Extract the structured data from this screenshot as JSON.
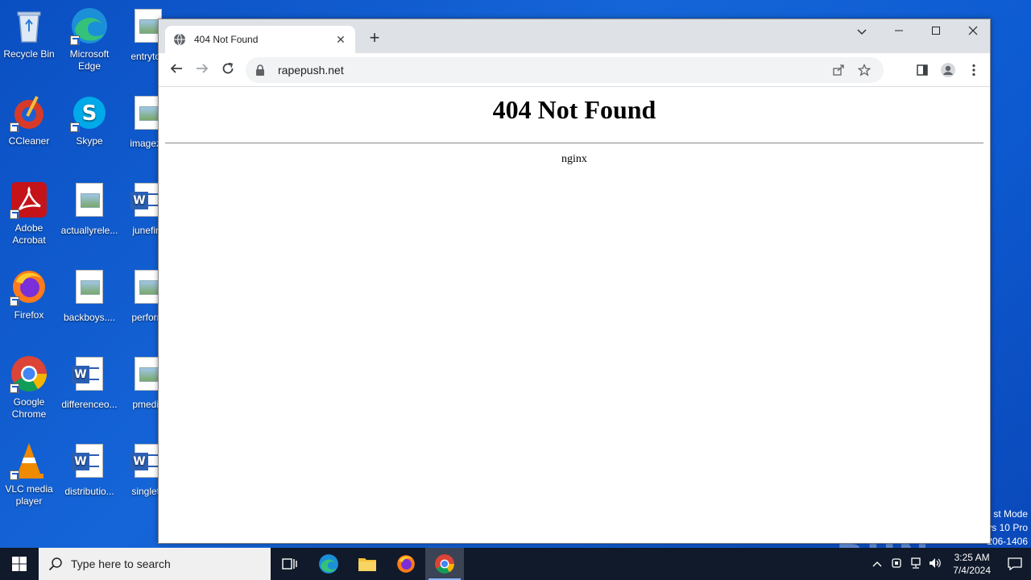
{
  "desktop": {
    "icons": [
      {
        "label": "Recycle Bin"
      },
      {
        "label": "Microsoft Edge"
      },
      {
        "label": "entrytod"
      },
      {
        "label": "CCleaner"
      },
      {
        "label": "Skype"
      },
      {
        "label": "imagezo"
      },
      {
        "label": "Adobe Acrobat"
      },
      {
        "label": "actuallyrele..."
      },
      {
        "label": "junefire"
      },
      {
        "label": "Firefox"
      },
      {
        "label": "backboys...."
      },
      {
        "label": "perform"
      },
      {
        "label": "Google Chrome"
      },
      {
        "label": "differenceo..."
      },
      {
        "label": "pmediu"
      },
      {
        "label": "VLC media player"
      },
      {
        "label": "distributio..."
      },
      {
        "label": "singleth"
      }
    ]
  },
  "browser": {
    "tab_title": "404 Not Found",
    "url": "rapepush.net",
    "close_tab_glyph": "✕",
    "new_tab_glyph": "+",
    "accent": "#1a73e8"
  },
  "page": {
    "heading": "404 Not Found",
    "server": "nginx"
  },
  "watermark": {
    "text": "ANY RUN",
    "sys_line1": "st Mode",
    "sys_line2": "vs 10 Pro",
    "sys_line3": "206-1406"
  },
  "taskbar": {
    "search_placeholder": "Type here to search",
    "time": "3:25 AM",
    "date": "7/4/2024"
  }
}
